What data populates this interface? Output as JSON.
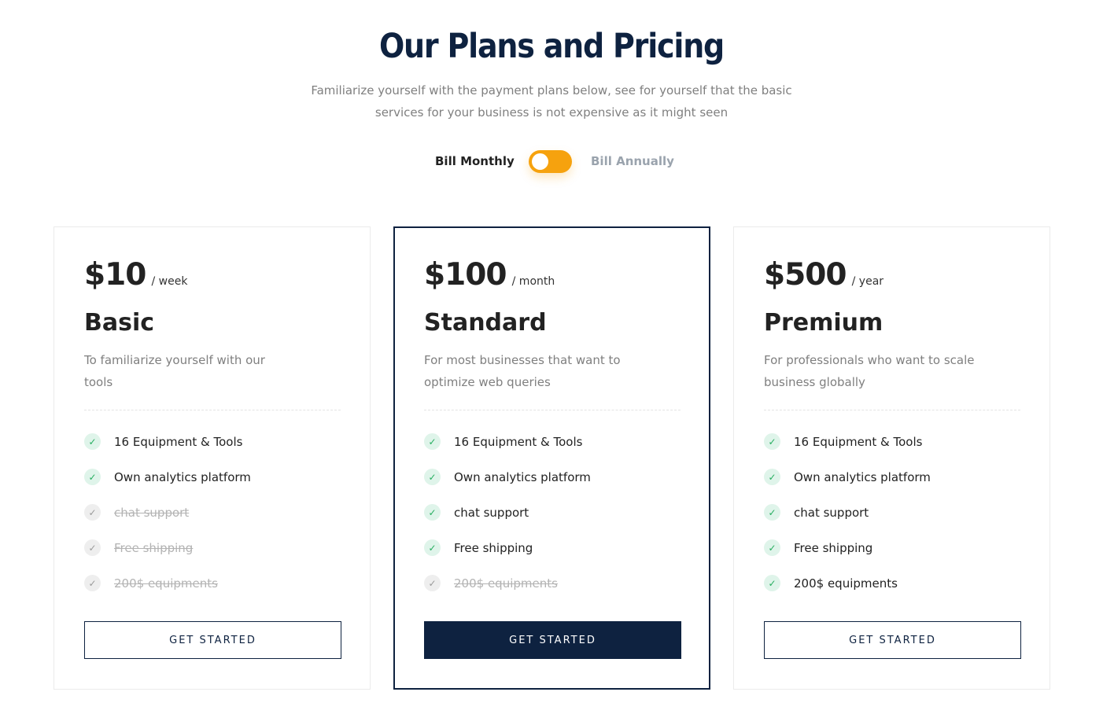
{
  "header": {
    "title": "Our Plans and Pricing",
    "subtitle_line1": "Familiarize yourself with the payment plans below, see for yourself that the basic",
    "subtitle_line2": "services for your business is not expensive as it might seen"
  },
  "billing": {
    "monthly_label": "Bill Monthly",
    "annually_label": "Bill Annually",
    "toggle_color": "#f6a20e"
  },
  "colors": {
    "brand_navy": "#0e2240",
    "check_green": "#27ae60"
  },
  "plans": [
    {
      "price": "$10",
      "period": "/ week",
      "name": "Basic",
      "description": "To familiarize yourself with our tools",
      "features": [
        {
          "label": "16 Equipment & Tools",
          "included": true
        },
        {
          "label": "Own analytics platform",
          "included": true
        },
        {
          "label": "chat support",
          "included": false
        },
        {
          "label": "Free shipping",
          "included": false
        },
        {
          "label": "200$ equipments",
          "included": false
        }
      ],
      "cta": "GET STARTED"
    },
    {
      "price": "$100",
      "period": "/ month",
      "name": "Standard",
      "description": "For most businesses that  want to optimize web queries",
      "features": [
        {
          "label": "16 Equipment & Tools",
          "included": true
        },
        {
          "label": "Own analytics platform",
          "included": true
        },
        {
          "label": "chat support",
          "included": true
        },
        {
          "label": "Free shipping",
          "included": true
        },
        {
          "label": "200$ equipments",
          "included": false
        }
      ],
      "cta": "GET STARTED"
    },
    {
      "price": "$500",
      "period": "/ year",
      "name": "Premium",
      "description": "For professionals who want to scale business globally",
      "features": [
        {
          "label": "16 Equipment & Tools",
          "included": true
        },
        {
          "label": "Own analytics platform",
          "included": true
        },
        {
          "label": "chat support",
          "included": true
        },
        {
          "label": "Free shipping",
          "included": true
        },
        {
          "label": "200$ equipments",
          "included": true
        }
      ],
      "cta": "GET STARTED"
    }
  ]
}
